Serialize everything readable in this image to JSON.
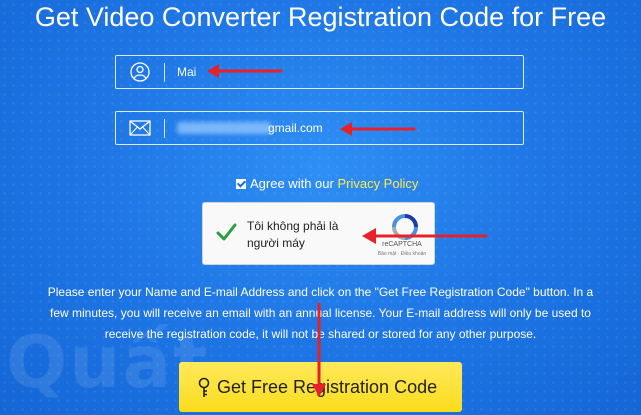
{
  "title": "Get Video Converter Registration Code for Free",
  "form": {
    "name_value": "Mai",
    "email_value": "gmail.com",
    "agree_text": "Agree with our",
    "privacy_link": "Privacy Policy"
  },
  "captcha": {
    "label": "Tôi không phải là người máy",
    "brand": "reCAPTCHA",
    "terms": "Bảo mật · Điều khoản"
  },
  "info_text": "Please enter your Name and E-mail Address and click on the \"Get Free Registration Code\" button. In a few minutes, you will receive an email with an annual license. Your E-mail address will only be used to receive the registration code, it will not be shared or stored for any other purpose.",
  "cta_label": "Get Free Registration Code",
  "watermark_text": "Quất",
  "colors": {
    "background": "#1f78e6",
    "button": "#fae03a",
    "link": "#ffe94a",
    "arrow": "#e8202a"
  },
  "icons": [
    "user-icon",
    "mail-icon",
    "check-icon",
    "recaptcha-icon",
    "key-icon",
    "arrow-icon"
  ]
}
